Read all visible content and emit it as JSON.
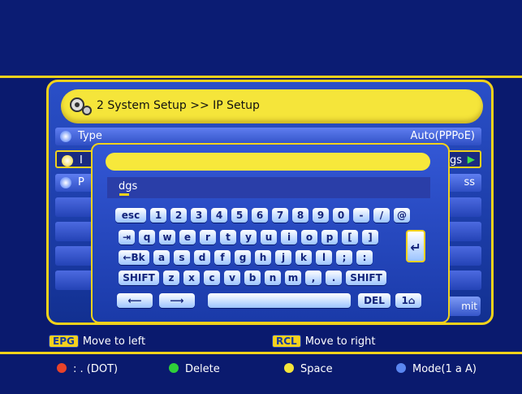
{
  "title": {
    "number": "2",
    "path": "System Setup >> IP Setup"
  },
  "rows": [
    {
      "label": "Type",
      "value": "Auto(PPPoE)"
    },
    {
      "label": "I",
      "value": "gs"
    },
    {
      "label": "P",
      "value": "ss"
    }
  ],
  "keyboard": {
    "text": "dgs",
    "rows": [
      [
        "esc",
        "1",
        "2",
        "3",
        "4",
        "5",
        "6",
        "7",
        "8",
        "9",
        "0",
        "-",
        "/",
        "@"
      ],
      [
        "⇥",
        "q",
        "w",
        "e",
        "r",
        "t",
        "y",
        "u",
        "i",
        "o",
        "p",
        "[",
        "]"
      ],
      [
        "←Bk",
        "a",
        "s",
        "d",
        "f",
        "g",
        "h",
        "j",
        "k",
        "l",
        ";",
        ":"
      ],
      [
        "SHIFT",
        "z",
        "x",
        "c",
        "v",
        "b",
        "n",
        "m",
        ",",
        ".",
        "SHIFT"
      ]
    ],
    "last_row": [
      "⟵",
      "⟶",
      "",
      "DEL",
      "1⌂"
    ],
    "enter": "↵"
  },
  "submit_label": "mit",
  "hints": [
    {
      "badge": "EPG",
      "text": "Move to left"
    },
    {
      "badge": "RCL",
      "text": "Move to right"
    }
  ],
  "legend": [
    {
      "color": "#e8432a",
      "text": ": . (DOT)"
    },
    {
      "color": "#2fcf3a",
      "text": "Delete"
    },
    {
      "color": "#f5e53a",
      "text": "Space"
    },
    {
      "color": "#5a86f0",
      "text": "Mode(1 a A)"
    }
  ],
  "colors": {
    "accent": "#f2d21b",
    "bg": "#0a1a6e"
  }
}
